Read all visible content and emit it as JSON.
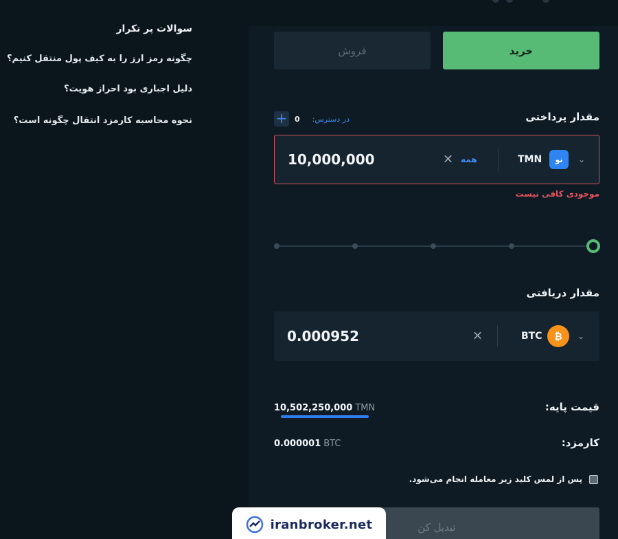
{
  "faq": {
    "title": "سوالات پر تکرار",
    "items": [
      "چگونه رمز ارز را به کیف پول منتقل کنیم؟",
      "دلیل اجباری بود احراز هویت؟",
      "نحوه محاسبه کارمزد انتقال چگونه است؟"
    ]
  },
  "tabs": {
    "buy": "خرید",
    "sell": "فروش",
    "active": "buy"
  },
  "payment": {
    "label": "مقدار پرداختی",
    "available_label": "در دسترس:",
    "available_value": "0",
    "amount": "10,000,000",
    "all_label": "همه",
    "currency_code": "TMN",
    "currency_icon": "novin-logo-icon",
    "currency_icon_text": "نو",
    "error": "موجودی کافی نیست"
  },
  "slider": {
    "level_percent": 100,
    "steps": 5
  },
  "receive": {
    "label": "مقدار دریافتی",
    "amount": "0.000952",
    "currency_code": "BTC",
    "currency_icon": "bitcoin-icon",
    "currency_icon_text": "₿"
  },
  "base_price": {
    "label": "قیمت پایه:",
    "value": "10,502,250,000",
    "unit": "TMN"
  },
  "fee": {
    "label": "کارمزد:",
    "value": "0.000001",
    "unit": "BTC"
  },
  "confirm_text": "پس از لمس کلید زیر معامله انجام می‌شود.",
  "convert_button": "تبدیل کن",
  "watermark": "iranbroker.net",
  "colors": {
    "accent_green": "#57bb76",
    "accent_blue": "#3d8bf2",
    "error_red": "#e2545c",
    "bitcoin_orange": "#f7931a"
  }
}
